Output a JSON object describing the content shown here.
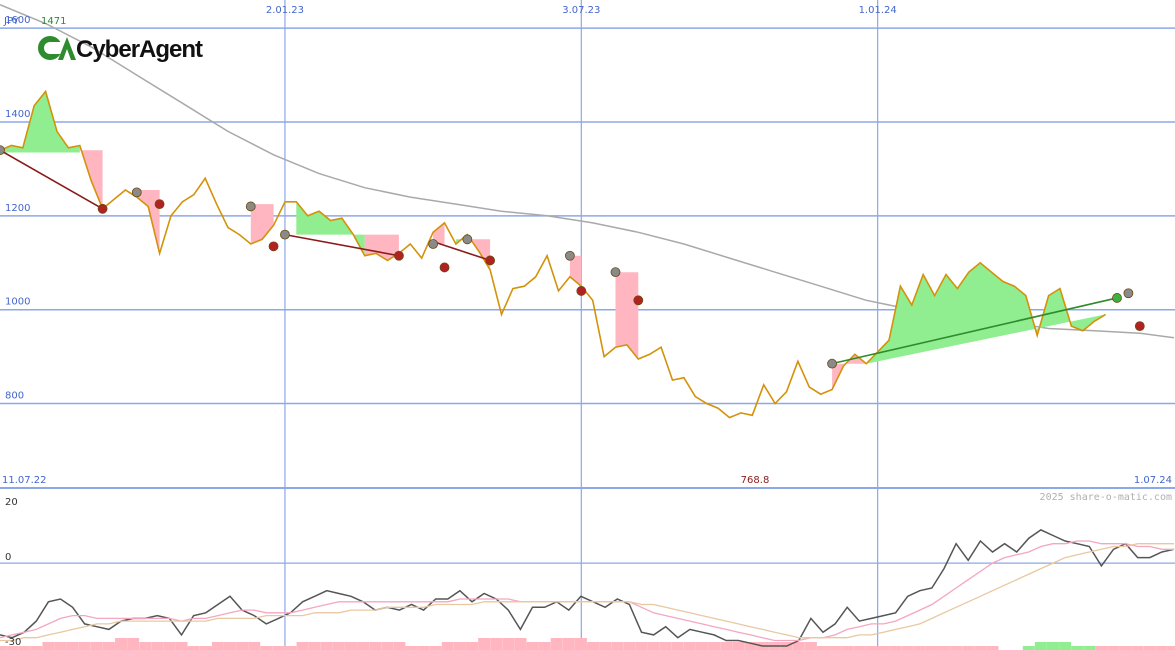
{
  "chart_data": [
    {
      "type": "line",
      "currency_label": "JPY",
      "last_price_label": "1471",
      "logo_text": "CyberAgent",
      "ylim": [
        620,
        1660
      ],
      "y_ticks": [
        {
          "value": 1600,
          "label": "1600"
        },
        {
          "value": 1400,
          "label": "1400"
        },
        {
          "value": 1200,
          "label": "1200"
        },
        {
          "value": 1000,
          "label": "1000"
        },
        {
          "value": 800,
          "label": "800"
        }
      ],
      "x_dates": [
        {
          "date": "2023-01-02",
          "label": "2.01.23"
        },
        {
          "date": "2023-07-03",
          "label": "3.07.23"
        },
        {
          "date": "2024-01-01",
          "label": "1.01.24"
        }
      ],
      "start_label": "11.07.22",
      "end_label": "1.07.24",
      "min_label": "768.8",
      "grid": true,
      "series": [
        {
          "role": "price",
          "color": "#d4920a",
          "dates": [
            "2022-07-11",
            "2022-07-18",
            "2022-07-25",
            "2022-08-01",
            "2022-08-08",
            "2022-08-15",
            "2022-08-22",
            "2022-08-29",
            "2022-09-05",
            "2022-09-12",
            "2022-09-19",
            "2022-09-26",
            "2022-10-03",
            "2022-10-10",
            "2022-10-17",
            "2022-10-24",
            "2022-10-31",
            "2022-11-07",
            "2022-11-14",
            "2022-11-21",
            "2022-11-28",
            "2022-12-05",
            "2022-12-12",
            "2022-12-19",
            "2022-12-26",
            "2023-01-02",
            "2023-01-09",
            "2023-01-16",
            "2023-01-23",
            "2023-01-30",
            "2023-02-06",
            "2023-02-13",
            "2023-02-20",
            "2023-02-27",
            "2023-03-06",
            "2023-03-13",
            "2023-03-20",
            "2023-03-27",
            "2023-04-03",
            "2023-04-10",
            "2023-04-17",
            "2023-04-24",
            "2023-05-01",
            "2023-05-08",
            "2023-05-15",
            "2023-05-22",
            "2023-05-29",
            "2023-06-05",
            "2023-06-12",
            "2023-06-19",
            "2023-06-26",
            "2023-07-03",
            "2023-07-10",
            "2023-07-17",
            "2023-07-24",
            "2023-07-31",
            "2023-08-07",
            "2023-08-14",
            "2023-08-21",
            "2023-08-28",
            "2023-09-04",
            "2023-09-11",
            "2023-09-18",
            "2023-09-25",
            "2023-10-02",
            "2023-10-09",
            "2023-10-16",
            "2023-10-23",
            "2023-10-30",
            "2023-11-06",
            "2023-11-13",
            "2023-11-20",
            "2023-11-27",
            "2023-12-04",
            "2023-12-11",
            "2023-12-18",
            "2023-12-25",
            "2024-01-01",
            "2024-01-08",
            "2024-01-15",
            "2024-01-22",
            "2024-01-29",
            "2024-02-05",
            "2024-02-12",
            "2024-02-19",
            "2024-02-26",
            "2024-03-04",
            "2024-03-11",
            "2024-03-18",
            "2024-03-25",
            "2024-04-01",
            "2024-04-08",
            "2024-04-15",
            "2024-04-22",
            "2024-04-29",
            "2024-05-06",
            "2024-05-13",
            "2024-05-20",
            "2024-05-27",
            "2024-06-03",
            "2024-06-10",
            "2024-06-17",
            "2024-06-24",
            "2024-07-01"
          ],
          "values": [
            1340,
            1350,
            1345,
            1435,
            1465,
            1380,
            1345,
            1350,
            1275,
            1215,
            1235,
            1255,
            1240,
            1220,
            1120,
            1200,
            1230,
            1245,
            1280,
            1225,
            1175,
            1160,
            1140,
            1150,
            1180,
            1230,
            1230,
            1200,
            1210,
            1190,
            1195,
            1160,
            1115,
            1120,
            1105,
            1120,
            1140,
            1110,
            1165,
            1185,
            1140,
            1160,
            1125,
            1085,
            990,
            1045,
            1050,
            1070,
            1115,
            1040,
            1070,
            1050,
            1020,
            900,
            920,
            925,
            895,
            905,
            920,
            850,
            855,
            815,
            800,
            790,
            770,
            780,
            775,
            840,
            800,
            825,
            890,
            835,
            820,
            830,
            880,
            905,
            885,
            910,
            935,
            1050,
            1010,
            1075,
            1030,
            1075,
            1045,
            1080,
            1100,
            1080,
            1060,
            1050,
            1030,
            945,
            1030,
            1045,
            965,
            955,
            975,
            990
          ],
          "start_date": "2022-07-11"
        },
        {
          "role": "moving-average",
          "color": "#a9a9a9",
          "dates": [
            "2022-07-11",
            "2022-08-08",
            "2022-09-05",
            "2022-10-03",
            "2022-10-31",
            "2022-11-28",
            "2022-12-26",
            "2023-01-23",
            "2023-02-20",
            "2023-03-20",
            "2023-04-17",
            "2023-05-15",
            "2023-06-12",
            "2023-07-10",
            "2023-08-07",
            "2023-09-04",
            "2023-10-02",
            "2023-10-30",
            "2023-11-27",
            "2023-12-25",
            "2024-01-22",
            "2024-02-19",
            "2024-03-18",
            "2024-04-15",
            "2024-05-13",
            "2024-06-10",
            "2024-07-01"
          ],
          "values": [
            1650,
            1610,
            1560,
            1500,
            1440,
            1380,
            1330,
            1290,
            1260,
            1240,
            1225,
            1210,
            1200,
            1185,
            1165,
            1140,
            1110,
            1080,
            1050,
            1020,
            1000,
            990,
            975,
            960,
            955,
            950,
            940
          ]
        }
      ],
      "signals": [
        {
          "from_date": "2022-07-11",
          "from_value": 1340,
          "to_date": "2022-09-12",
          "to_value": 1215,
          "color": "#8b1a1a"
        },
        {
          "from_date": "2023-01-02",
          "from_value": 1160,
          "to_date": "2023-03-13",
          "to_value": 1115,
          "color": "#8b1a1a"
        },
        {
          "from_date": "2023-04-03",
          "from_value": 1145,
          "to_date": "2023-05-08",
          "to_value": 1105,
          "color": "#8b1a1a"
        },
        {
          "from_date": "2023-12-04",
          "from_value": 885,
          "to_date": "2024-05-27",
          "to_value": 1025,
          "color": "#2e8b2e"
        }
      ],
      "markers": [
        {
          "date": "2022-07-11",
          "value": 1340,
          "kind": "gray"
        },
        {
          "date": "2022-09-12",
          "value": 1215,
          "kind": "red"
        },
        {
          "date": "2022-10-03",
          "value": 1250,
          "kind": "gray"
        },
        {
          "date": "2022-10-17",
          "value": 1225,
          "kind": "red"
        },
        {
          "date": "2022-12-12",
          "value": 1220,
          "kind": "gray"
        },
        {
          "date": "2022-12-26",
          "value": 1135,
          "kind": "red"
        },
        {
          "date": "2023-01-02",
          "value": 1160,
          "kind": "gray"
        },
        {
          "date": "2023-03-13",
          "value": 1115,
          "kind": "red"
        },
        {
          "date": "2023-04-03",
          "value": 1140,
          "kind": "gray"
        },
        {
          "date": "2023-04-10",
          "value": 1090,
          "kind": "red"
        },
        {
          "date": "2023-04-24",
          "value": 1150,
          "kind": "gray"
        },
        {
          "date": "2023-05-08",
          "value": 1105,
          "kind": "red"
        },
        {
          "date": "2023-06-26",
          "value": 1115,
          "kind": "gray"
        },
        {
          "date": "2023-07-03",
          "value": 1040,
          "kind": "red"
        },
        {
          "date": "2023-07-24",
          "value": 1080,
          "kind": "gray"
        },
        {
          "date": "2023-08-07",
          "value": 1020,
          "kind": "red"
        },
        {
          "date": "2023-12-04",
          "value": 885,
          "kind": "gray"
        },
        {
          "date": "2024-05-27",
          "value": 1025,
          "kind": "green"
        },
        {
          "date": "2024-06-03",
          "value": 1035,
          "kind": "gray"
        },
        {
          "date": "2024-06-10",
          "value": 965,
          "kind": "red"
        }
      ],
      "zones": [
        {
          "kind": "up",
          "from": "2022-07-11",
          "to": "2022-08-29",
          "base": 1335
        },
        {
          "kind": "down",
          "from": "2022-08-29",
          "to": "2022-09-12",
          "base": 1340
        },
        {
          "kind": "down",
          "from": "2022-10-03",
          "to": "2022-10-17",
          "base": 1255
        },
        {
          "kind": "down",
          "from": "2022-12-12",
          "to": "2022-12-26",
          "base": 1225
        },
        {
          "kind": "up",
          "from": "2023-01-09",
          "to": "2023-02-20",
          "base": 1160
        },
        {
          "kind": "down",
          "from": "2023-02-20",
          "to": "2023-03-13",
          "base": 1160
        },
        {
          "kind": "down",
          "from": "2023-04-03",
          "to": "2023-04-10",
          "base": 1140
        },
        {
          "kind": "up",
          "from": "2023-04-17",
          "to": "2023-04-24",
          "base": 1150
        },
        {
          "kind": "down",
          "from": "2023-04-24",
          "to": "2023-05-08",
          "base": 1150
        },
        {
          "kind": "down",
          "from": "2023-06-26",
          "to": "2023-07-03",
          "base": 1115
        },
        {
          "kind": "down",
          "from": "2023-07-24",
          "to": "2023-08-07",
          "base": 1080
        },
        {
          "kind": "down",
          "from": "2023-12-04",
          "to": "2023-12-25",
          "base": 885
        },
        {
          "kind": "up",
          "from": "2023-12-25",
          "to": "2024-05-27",
          "base": 885
        },
        {
          "kind": "down",
          "from": "2024-06-03",
          "to": "2024-06-10",
          "base": 1035
        }
      ],
      "colors": {
        "up": "#90ee90",
        "down": "#ffb6c1",
        "grid": "#8da8e8",
        "axis_text": "#4466cc"
      }
    },
    {
      "type": "line",
      "watermark": "2025 share-o-matic.com",
      "ylim": [
        -30,
        25
      ],
      "y_ticks": [
        {
          "value": 20,
          "label": "20"
        },
        {
          "value": 0,
          "label": "0"
        },
        {
          "value": -30,
          "label": "-30"
        }
      ],
      "series": [
        {
          "role": "oscillator",
          "color": "#555555",
          "values": [
            -26,
            -27,
            -25,
            -21,
            -14,
            -13,
            -16,
            -22,
            -23,
            -24,
            -21,
            -20,
            -20,
            -19,
            -20,
            -26,
            -19,
            -18,
            -15,
            -12,
            -17,
            -19,
            -22,
            -20,
            -18,
            -14,
            -12,
            -10,
            -11,
            -12,
            -14,
            -17,
            -16,
            -17,
            -15,
            -17,
            -13,
            -13,
            -10,
            -14,
            -11,
            -13,
            -17,
            -24,
            -16,
            -16,
            -14,
            -17,
            -12,
            -14,
            -16,
            -13,
            -15,
            -25,
            -26,
            -23,
            -27,
            -24,
            -25,
            -26,
            -28,
            -28,
            -29,
            -30,
            -30,
            -30,
            -28,
            -20,
            -25,
            -22,
            -16,
            -21,
            -20,
            -19,
            -18,
            -12,
            -10,
            -9,
            -2,
            7,
            1,
            8,
            4,
            7,
            4,
            9,
            12,
            10,
            8,
            7,
            6,
            -1,
            5,
            7,
            2,
            2,
            4,
            5
          ]
        },
        {
          "role": "signal-fast",
          "color": "#f4a6c0",
          "values": [
            -27,
            -26,
            -25,
            -24,
            -22,
            -20,
            -19,
            -19,
            -20,
            -20,
            -20,
            -20,
            -20,
            -20,
            -20,
            -21,
            -20,
            -20,
            -19,
            -18,
            -17,
            -17,
            -18,
            -18,
            -18,
            -17,
            -16,
            -15,
            -14,
            -14,
            -14,
            -14,
            -14,
            -14,
            -14,
            -14,
            -14,
            -14,
            -13,
            -13,
            -13,
            -13,
            -13,
            -14,
            -14,
            -14,
            -14,
            -14,
            -14,
            -14,
            -14,
            -14,
            -14,
            -16,
            -18,
            -19,
            -20,
            -21,
            -22,
            -23,
            -24,
            -25,
            -26,
            -27,
            -28,
            -28,
            -28,
            -27,
            -27,
            -26,
            -24,
            -23,
            -22,
            -22,
            -21,
            -19,
            -17,
            -15,
            -12,
            -9,
            -6,
            -3,
            0,
            2,
            3,
            4,
            6,
            7,
            7,
            8,
            8,
            7,
            7,
            7,
            6,
            6,
            5,
            5
          ]
        },
        {
          "role": "signal-slow",
          "color": "#e8c8a0",
          "values": [
            -28,
            -28,
            -27,
            -27,
            -26,
            -25,
            -24,
            -23,
            -22,
            -22,
            -21,
            -21,
            -21,
            -21,
            -21,
            -21,
            -21,
            -21,
            -20,
            -20,
            -20,
            -20,
            -19,
            -19,
            -19,
            -19,
            -18,
            -18,
            -18,
            -17,
            -17,
            -17,
            -16,
            -16,
            -16,
            -16,
            -15,
            -15,
            -15,
            -15,
            -14,
            -14,
            -14,
            -14,
            -14,
            -14,
            -14,
            -14,
            -14,
            -14,
            -14,
            -14,
            -14,
            -15,
            -15,
            -16,
            -17,
            -18,
            -19,
            -20,
            -21,
            -22,
            -23,
            -24,
            -25,
            -26,
            -27,
            -27,
            -27,
            -27,
            -27,
            -26,
            -26,
            -25,
            -24,
            -23,
            -22,
            -20,
            -18,
            -16,
            -14,
            -12,
            -10,
            -8,
            -6,
            -4,
            -2,
            0,
            2,
            3,
            4,
            5,
            6,
            6,
            7,
            7,
            7,
            7
          ]
        }
      ],
      "histogram": {
        "up_color": "#90ee90",
        "down_color": "#ffb6c1",
        "values": [
          -1,
          -1,
          -1,
          -1,
          -2,
          -2,
          -2,
          -2,
          -2,
          -2,
          -3,
          -3,
          -2,
          -2,
          -2,
          -2,
          -1,
          -1,
          -2,
          -2,
          -2,
          -2,
          -1,
          -1,
          -1,
          -2,
          -2,
          -2,
          -2,
          -2,
          -2,
          -2,
          -2,
          -2,
          -1,
          -1,
          -1,
          -2,
          -2,
          -2,
          -3,
          -3,
          -3,
          -3,
          -2,
          -2,
          -3,
          -3,
          -3,
          -2,
          -2,
          -2,
          -2,
          -2,
          -2,
          -2,
          -2,
          -2,
          -2,
          -2,
          -2,
          -2,
          -2,
          -2,
          -2,
          -2,
          -2,
          -2,
          -1,
          -1,
          -1,
          -1,
          -1,
          -1,
          -1,
          -1,
          -1,
          -1,
          -1,
          -1,
          -1,
          -1,
          -1,
          0,
          0,
          1,
          2,
          2,
          2,
          1,
          1,
          -1,
          -1,
          -1,
          -1,
          -1,
          -1,
          -1
        ]
      }
    }
  ]
}
